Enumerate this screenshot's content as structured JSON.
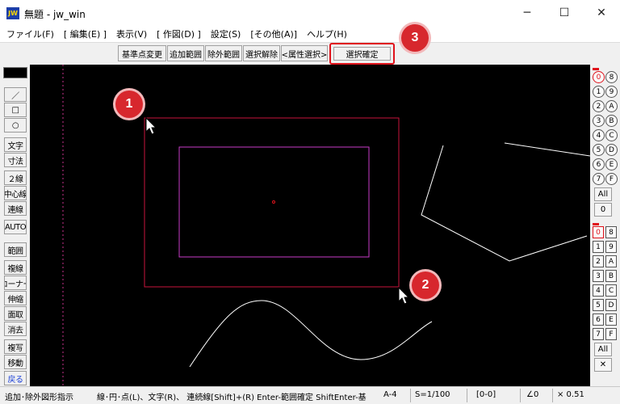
{
  "window": {
    "title": "無題 - jw_win",
    "app_icon_text": "JW",
    "minimize_glyph": "─",
    "maximize_glyph": "☐",
    "close_glyph": "✕"
  },
  "menu": [
    "ファイル(F)",
    "[ 編集(E) ]",
    "表示(V)",
    "[ 作図(D) ]",
    "設定(S)",
    "[その他(A)]",
    "ヘルプ(H)"
  ],
  "toolbar": {
    "buttons": [
      "基準点変更",
      "追加範囲",
      "除外範囲",
      "選択解除",
      "<属性選択>"
    ],
    "confirm_label": "選択確定"
  },
  "left_toolbar": {
    "buttons": [
      "／",
      "□",
      "○",
      "文字",
      "寸法",
      "２線",
      "中心線",
      "連線",
      "AUTO",
      "範囲",
      "複線",
      "コーナー",
      "伸縮",
      "面取",
      "消去",
      "複写",
      "移動",
      "戻る"
    ]
  },
  "right_panel": {
    "group1": [
      [
        "0",
        "8"
      ],
      [
        "1",
        "9"
      ],
      [
        "2",
        "A"
      ],
      [
        "3",
        "B"
      ],
      [
        "4",
        "C"
      ],
      [
        "5",
        "D"
      ],
      [
        "6",
        "E"
      ],
      [
        "7",
        "F"
      ]
    ],
    "group1_all": "All",
    "group1_current": "0",
    "group2": [
      [
        "0",
        "8"
      ],
      [
        "1",
        "9"
      ],
      [
        "2",
        "A"
      ],
      [
        "3",
        "B"
      ],
      [
        "4",
        "C"
      ],
      [
        "5",
        "D"
      ],
      [
        "6",
        "E"
      ],
      [
        "7",
        "F"
      ]
    ],
    "group2_all": "All",
    "group2_cross": "✕"
  },
  "status": {
    "mode": "追加･除外図形指示",
    "hint": "線･円･点(L)、文字(R)、 連続線[Shift]+(R)  Enter-範囲確定  ShiftEnter-基",
    "paper": "A-4",
    "scale": "S=1/100",
    "layer": "[0-0]",
    "angle": "∠0",
    "factor": "× 0.51"
  },
  "callouts": [
    "1",
    "2",
    "3"
  ],
  "colors": {
    "canvas": "#000000",
    "outer_rect": "#c8143c",
    "inner_rect": "#c83cc8",
    "lines": "#ffffff",
    "callout": "#d7272d",
    "highlight": "#e0121b"
  }
}
